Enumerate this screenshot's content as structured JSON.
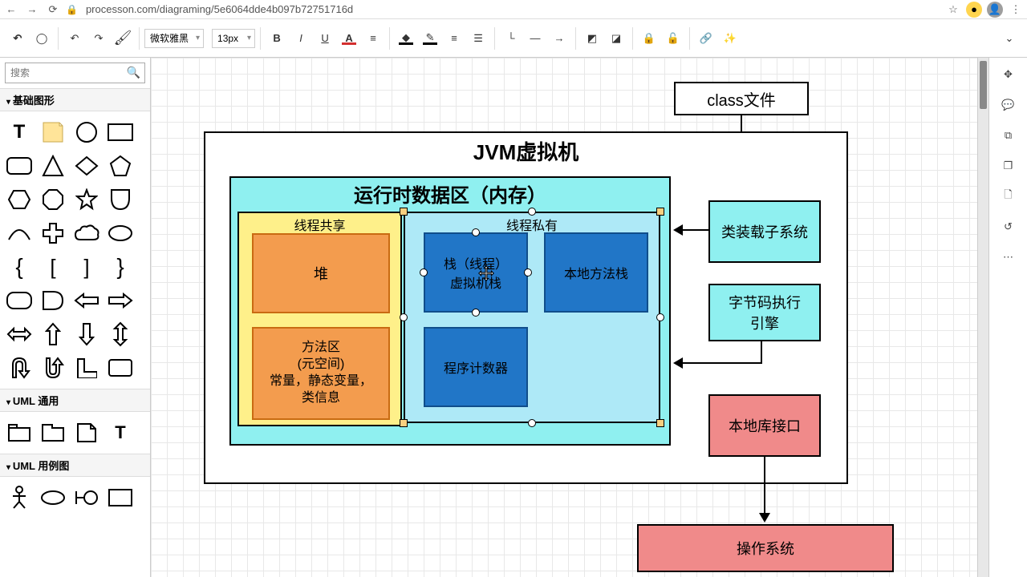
{
  "browser": {
    "url": "processon.com/diagraming/5e6064dde4b097b72751716d"
  },
  "toolbar": {
    "font_family": "微软雅黑",
    "font_size": "13px"
  },
  "sidebar": {
    "search_placeholder": "搜索",
    "cat_basic": "基础图形",
    "cat_uml_common": "UML 通用",
    "cat_uml_usecase": "UML 用例图"
  },
  "diagram": {
    "class_file": "class文件",
    "jvm_title": "JVM虚拟机",
    "runtime_area": "运行时数据区（内存）",
    "thread_shared": "线程共享",
    "thread_private": "线程私有",
    "heap": "堆",
    "method_area_l1": "方法区",
    "method_area_l2": "(元空间)",
    "method_area_l3": "常量，静态变量，",
    "method_area_l4": "类信息",
    "stack_l1": "栈（线程）",
    "stack_l2": "虚拟机栈",
    "native_stack": "本地方法栈",
    "pc_register": "程序计数器",
    "class_loader": "类装载子系统",
    "exec_engine_l1": "字节码执行",
    "exec_engine_l2": "引擎",
    "native_interface": "本地库接口",
    "os": "操作系统"
  }
}
